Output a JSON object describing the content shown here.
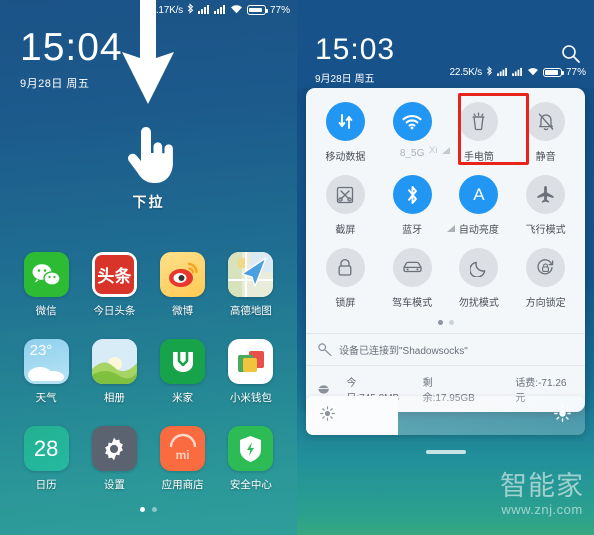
{
  "left_phone": {
    "status_bar": {
      "net_speed": "1.17K/s",
      "battery_pct": "77%",
      "icons": [
        "bluetooth-icon",
        "signal-icon",
        "signal-icon-2",
        "wifi-icon",
        "battery-icon"
      ]
    },
    "clock": {
      "time": "15:04",
      "date": "9月28日 周五"
    },
    "gesture": {
      "label": "下拉",
      "arrow_icon": "down-arrow-icon",
      "hand_icon": "pointing-hand-icon"
    },
    "apps": [
      {
        "label": "微信",
        "icon": "wechat-icon",
        "cls": "ic-wechat"
      },
      {
        "label": "今日头条",
        "icon": "toutiao-icon",
        "cls": "ic-toutiao"
      },
      {
        "label": "微博",
        "icon": "weibo-icon",
        "cls": "ic-weibo"
      },
      {
        "label": "高德地图",
        "icon": "amap-icon",
        "cls": "ic-amap"
      },
      {
        "label": "天气",
        "icon": "weather-icon",
        "cls": "ic-weather",
        "badge": "23°"
      },
      {
        "label": "相册",
        "icon": "gallery-icon",
        "cls": "ic-gallery"
      },
      {
        "label": "米家",
        "icon": "mihome-icon",
        "cls": "ic-mihome"
      },
      {
        "label": "小米钱包",
        "icon": "mi-wallet-icon",
        "cls": "ic-wallet"
      },
      {
        "label": "日历",
        "icon": "calendar-icon",
        "cls": "ic-calendar",
        "badge": "28"
      },
      {
        "label": "设置",
        "icon": "gear-icon",
        "cls": "ic-settings"
      },
      {
        "label": "应用商店",
        "icon": "app-store-icon",
        "cls": "ic-store",
        "badge": "mi"
      },
      {
        "label": "安全中心",
        "icon": "shield-icon",
        "cls": "ic-security"
      }
    ],
    "page_dots": {
      "count": 2,
      "active": 0
    }
  },
  "right_phone": {
    "clock": {
      "time": "15:03",
      "date": "9月28日 周五"
    },
    "search_icon": "search-icon",
    "status_bar": {
      "net_speed": "22.5K/s",
      "battery_pct": "77%"
    },
    "quick_settings": {
      "tiles": [
        {
          "label": "移动数据",
          "icon": "mobile-data-icon",
          "active": true
        },
        {
          "label": "8_5G",
          "icon": "wifi-icon",
          "active": true,
          "sub": "Xi"
        },
        {
          "label": "手电筒",
          "icon": "flashlight-icon",
          "active": false,
          "highlighted": true
        },
        {
          "label": "静音",
          "icon": "mute-bell-icon",
          "active": false
        },
        {
          "label": "截屏",
          "icon": "screenshot-icon",
          "active": false
        },
        {
          "label": "蓝牙",
          "icon": "bluetooth-icon",
          "active": true
        },
        {
          "label": "自动亮度",
          "icon": "auto-brightness-icon",
          "active": true
        },
        {
          "label": "飞行模式",
          "icon": "airplane-icon",
          "active": false
        },
        {
          "label": "锁屏",
          "icon": "lock-icon",
          "active": false
        },
        {
          "label": "驾车模式",
          "icon": "car-icon",
          "active": false
        },
        {
          "label": "勿扰模式",
          "icon": "moon-icon",
          "active": false
        },
        {
          "label": "方向锁定",
          "icon": "rotation-lock-icon",
          "active": false
        }
      ],
      "page_dots": {
        "count": 2,
        "active": 0
      },
      "vpn_row": {
        "icon": "vpn-key-icon",
        "text": "设备已连接到\"Shadowsocks\""
      },
      "data_row": {
        "icon": "data-usage-icon",
        "today": "今日:745.8MB",
        "remaining": "剩余:17.95GB",
        "fee": "话费:-71.26元"
      }
    },
    "brightness": {
      "value_pct": 33,
      "low_icon": "sun-small-icon",
      "high_icon": "sun-large-icon"
    },
    "home_handle": "home-indicator"
  },
  "watermark": {
    "cn": "智能家",
    "url": "www.znj.com"
  },
  "colors": {
    "accent_blue": "#2196f3",
    "highlight_red": "#e8241a",
    "panel_bg": "#f4f7fa"
  }
}
